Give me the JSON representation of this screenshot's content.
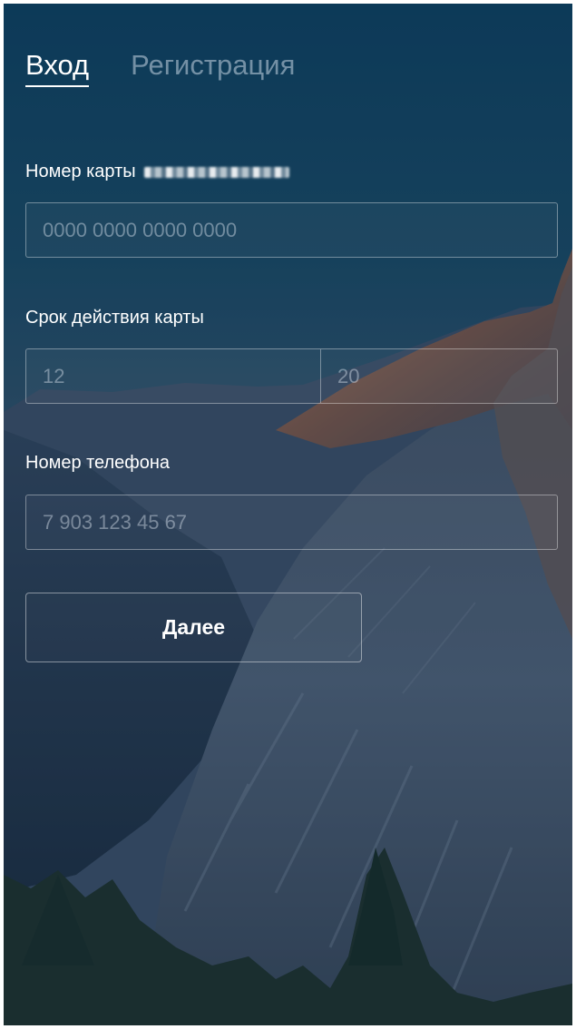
{
  "tabs": {
    "login": "Вход",
    "register": "Регистрация"
  },
  "card_number": {
    "label": "Номер карты",
    "placeholder": "0000 0000 0000 0000"
  },
  "expiry": {
    "label": "Срок действия карты",
    "month_placeholder": "12",
    "year_placeholder": "20"
  },
  "phone": {
    "label": "Номер телефона",
    "placeholder": "7 903 123 45 67"
  },
  "submit": {
    "label": "Далее"
  },
  "colors": {
    "sky_top": "#0c4060",
    "text": "#ffffff",
    "tab_inactive": "#8fa4b6"
  }
}
